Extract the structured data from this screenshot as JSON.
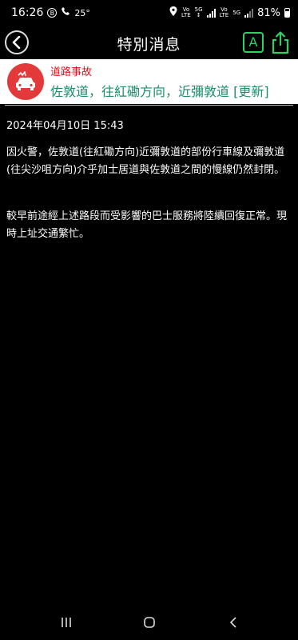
{
  "status_bar": {
    "time": "16:26",
    "badge_letter": "B",
    "temperature": "25°",
    "battery_percent": "81%",
    "icons": [
      "location-icon",
      "volte-icon",
      "5g-icon",
      "signal-icon",
      "battery-icon"
    ]
  },
  "header": {
    "title": "特別消息",
    "font_button_label": "A"
  },
  "banner": {
    "category": "道路事故",
    "headline": "佐敦道，往紅磡方向，近彌敦道 [更新]",
    "category_color": "#e0101a",
    "headline_color": "#1a8e6a",
    "icon_bg_color": "#e23a3a"
  },
  "article": {
    "datetime": "2024年04月10日 15:43",
    "paragraph1": "因火警，佐敦道(往紅磡方向)近彌敦道的部份行車線及彌敦道(往尖沙咀方向)介乎加士居道與佐敦道之間的慢線仍然封閉。",
    "paragraph2": "較早前途經上述路段而受影響的巴士服務將陸續回復正常。現時上址交通繁忙。"
  },
  "colors": {
    "accent_green": "#2fcf66",
    "background": "#000000"
  }
}
